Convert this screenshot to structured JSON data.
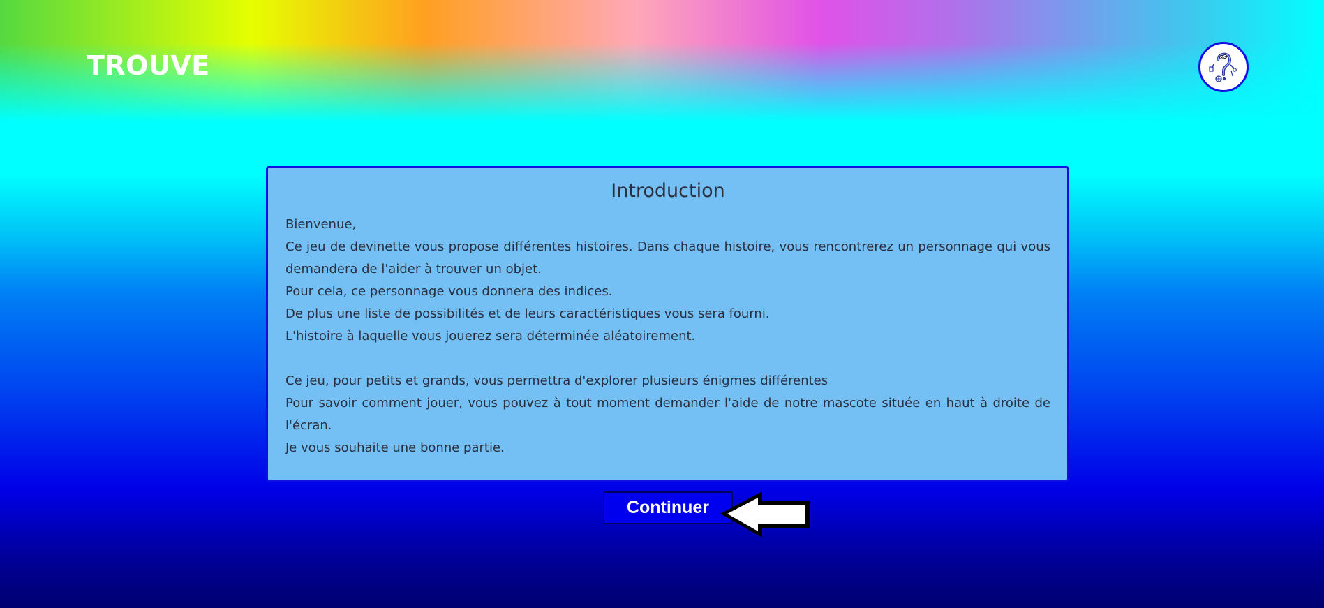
{
  "header": {
    "logo_text": "TROUVE",
    "help_icon": "question-mark-mascot-icon"
  },
  "intro": {
    "title": "Introduction",
    "lines": [
      "Bienvenue,",
      "Ce jeu de devinette vous propose différentes histoires. Dans chaque histoire, vous rencontrerez un personnage qui vous demandera de l'aider à trouver un objet.",
      "Pour cela, ce personnage vous donnera des indices.",
      "De plus une liste de possibilités et de leurs caractéristiques vous sera fourni.",
      "L'histoire à laquelle vous jouerez sera déterminée aléatoirement.",
      "Ce jeu, pour petits et grands, vous permettra d'explorer plusieurs énigmes différentes",
      "Pour savoir comment jouer, vous pouvez à tout moment demander l'aide de notre mascote située en haut à droite de l'écran.",
      "Je vous souhaite une bonne partie."
    ]
  },
  "actions": {
    "continue_label": "Continuer",
    "pointer_icon": "arrow-left-icon"
  },
  "colors": {
    "accent_blue": "#0000ee",
    "panel_bg": "#74c0f4",
    "border": "#1010e0"
  }
}
